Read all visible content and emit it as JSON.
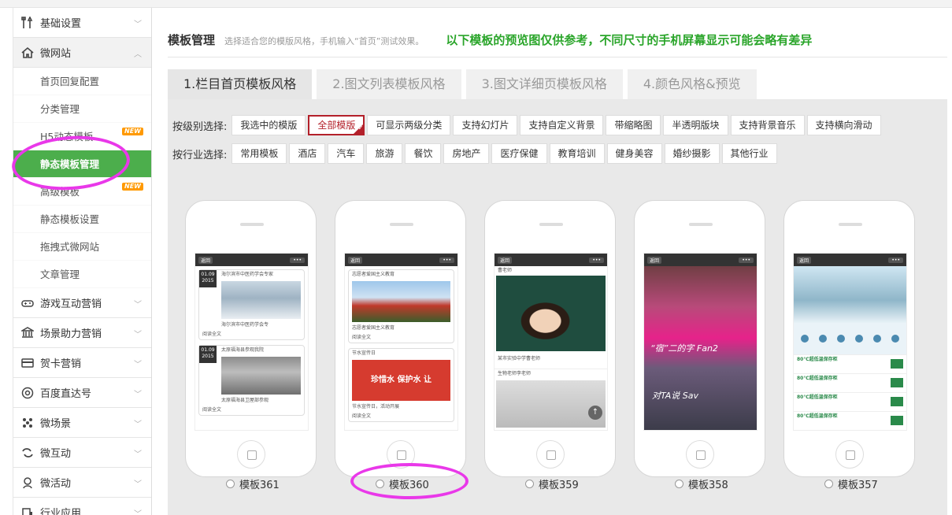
{
  "sidebar": {
    "groups": [
      {
        "label": "基础设置",
        "icon": "tools-icon"
      },
      {
        "label": "微网站",
        "icon": "home-icon"
      },
      {
        "label": "游戏互动营销",
        "icon": "gamepad-icon"
      },
      {
        "label": "场景助力营销",
        "icon": "bank-icon"
      },
      {
        "label": "贺卡营销",
        "icon": "card-icon"
      },
      {
        "label": "百度直达号",
        "icon": "baidu-icon"
      },
      {
        "label": "微场景",
        "icon": "scene-icon"
      },
      {
        "label": "微互动",
        "icon": "interact-icon"
      },
      {
        "label": "微活动",
        "icon": "activity-icon"
      },
      {
        "label": "行业应用",
        "icon": "industry-icon"
      }
    ],
    "sub_items": [
      {
        "label": "首页回复配置"
      },
      {
        "label": "分类管理"
      },
      {
        "label": "H5动态模板",
        "badge": "NEW"
      },
      {
        "label": "静态模板管理"
      },
      {
        "label": "高级模板",
        "badge": "NEW"
      },
      {
        "label": "静态模板设置"
      },
      {
        "label": "拖拽式微网站"
      },
      {
        "label": "文章管理"
      }
    ]
  },
  "header": {
    "title": "模板管理",
    "desc": "选择适合您的模版风格，手机输入“首页”测试效果。",
    "note": "以下模板的预览图仅供参考，不同尺寸的手机屏幕显示可能会略有差异"
  },
  "tabs": [
    "1.栏目首页模板风格",
    "2.图文列表模板风格",
    "3.图文详细页模板风格",
    "4.颜色风格&预览"
  ],
  "filters": {
    "level_label": "按级别选择:",
    "level_options": [
      "我选中的模版",
      "全部模版",
      "可显示两级分类",
      "支持幻灯片",
      "支持自定义背景",
      "带缩略图",
      "半透明版块",
      "支持背景音乐",
      "支持横向滑动"
    ],
    "industry_label": "按行业选择:",
    "industry_options": [
      "常用模板",
      "酒店",
      "汽车",
      "旅游",
      "餐饮",
      "房地产",
      "医疗保健",
      "教育培训",
      "健身美容",
      "婚纱摄影",
      "其他行业"
    ]
  },
  "templates": [
    {
      "name": "模板361"
    },
    {
      "name": "模板360"
    },
    {
      "name": "模板359"
    },
    {
      "name": "模板358"
    },
    {
      "name": "模板357"
    }
  ],
  "phone_ui": {
    "back": "返回",
    "more": "•••"
  },
  "previews": {
    "p361": {
      "date1_day": "01.09",
      "date1_year": "2015",
      "title1": "海尔滨市中医药学会专家",
      "caption1": "海尔滨市中医药学会专",
      "read": "阅读全文",
      "date2_day": "01.09",
      "date2_year": "2015",
      "title2": "太原福海县参观我院",
      "caption2": "太原福海县卫屋部参观"
    },
    "p360": {
      "title1": "志愿者爱国主义教育",
      "caption1": "志愿者爱国主义教育",
      "read": "阅读全文",
      "title2": "节水宣传日",
      "banner": "珍惜水 保护水 让",
      "caption2": "节水宣传日，活动开展"
    },
    "p359": {
      "teacher": "曹老师",
      "caption": "某市实验中学曹老师",
      "teacher2": "生物老师李老师"
    },
    "p358": {
      "text1": "“宿”二的字 Fan2",
      "text2": "对TA说 Sav"
    },
    "p357": {
      "items": [
        "80℃超低温保存柜",
        "80℃超低温保存柜",
        "80℃超低温保存柜",
        "80℃超低温保存柜"
      ]
    }
  }
}
